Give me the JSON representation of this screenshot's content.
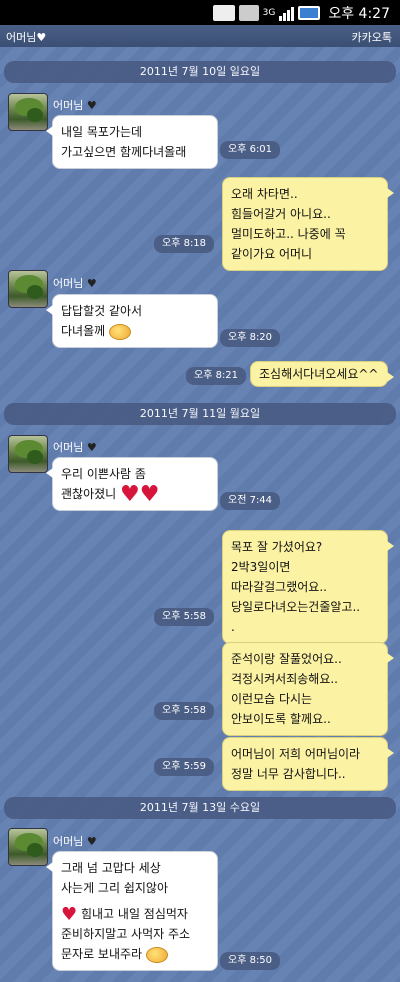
{
  "status": {
    "clock": "오후 4:27",
    "network": "3G"
  },
  "header": {
    "title": "어머님♥",
    "right": "카카오톡"
  },
  "dates": [
    "2011년 7월 10일 일요일",
    "2011년 7월 11일 월요일",
    "2011년 7월 13일 수요일"
  ],
  "sender": {
    "name": "어머님"
  },
  "messages": [
    {
      "from": "them",
      "lines": [
        "내일 목포가는데",
        "가고싶으면 함께다녀올래"
      ],
      "time": "오후 6:01"
    },
    {
      "from": "me",
      "lines": [
        "오래 차타면..",
        "힘들어갈거 아니요..",
        "멀미도하고.. 나중에 꼭",
        "같이가요 어머니"
      ],
      "time": "오후 8:18"
    },
    {
      "from": "them",
      "lines": [
        "답답할것 같아서",
        "다녀올께"
      ],
      "time": "오후 8:20"
    },
    {
      "from": "me",
      "lines": [
        "조심해서다녀오세요^^"
      ],
      "time": "오후 8:21"
    },
    {
      "from": "them",
      "lines": [
        "우리 이쁜사람 좀",
        "괜찮아졌니"
      ],
      "time": "오전 7:44"
    },
    {
      "from": "me",
      "lines": [
        "목포 잘 가셨어요?",
        "2박3일이면",
        "따라갈걸그랬어요..",
        "당일로다녀오는건줄알고..",
        "."
      ],
      "time": "오후 5:58"
    },
    {
      "from": "me",
      "lines": [
        "준석이랑 잘풀었어요..",
        "걱정시켜서죄송해요..",
        "이런모습 다시는",
        "안보이도록 할께요.."
      ],
      "time": "오후 5:58"
    },
    {
      "from": "me",
      "lines": [
        "어머님이 저희 어머님이라",
        "정말 너무 감사합니다.."
      ],
      "time": "오후 5:59"
    },
    {
      "from": "them",
      "lines": [
        "그래 넘 고맙다 세상",
        "사는게 그리 쉽지않아",
        "힘내고 내일 점심먹자",
        "준비하지말고 사먹자 주소",
        "문자로 보내주라"
      ],
      "time": "오후 8:50"
    }
  ]
}
